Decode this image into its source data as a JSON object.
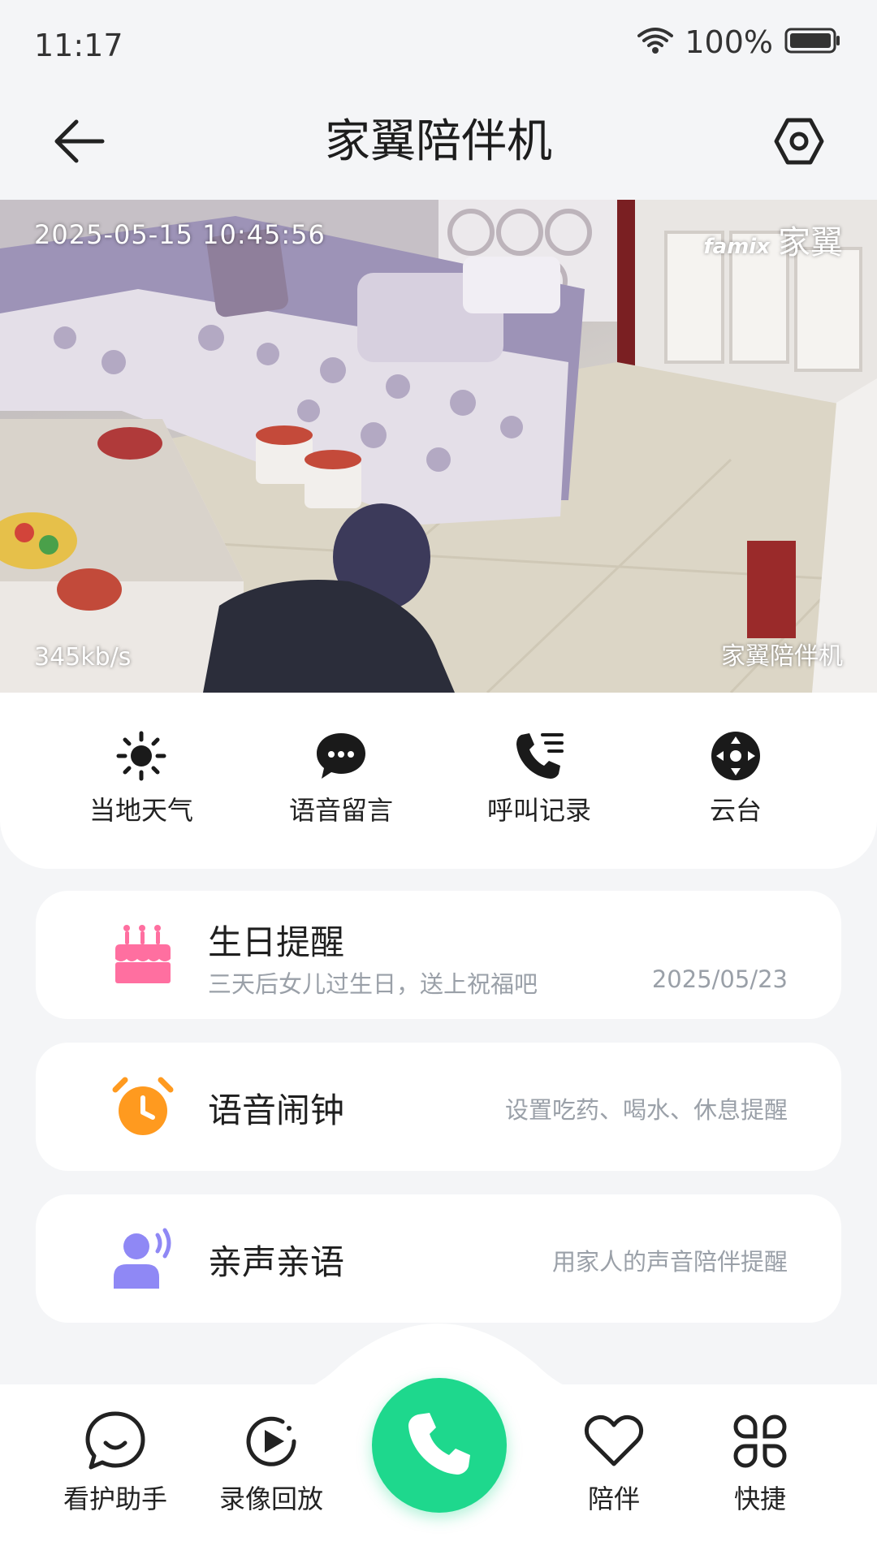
{
  "status_bar": {
    "time": "11:17",
    "battery_percent": "100%",
    "wifi_icon": "wifi-icon",
    "battery_icon": "battery-icon"
  },
  "header": {
    "title": "家翼陪伴机",
    "back_icon": "arrow-left-icon",
    "settings_icon": "hexagon-settings-icon"
  },
  "video": {
    "timestamp": "2025-05-15  10:45:56",
    "brand_en": "famix",
    "brand_cn": "家翼",
    "bitrate": "345kb/s",
    "device_label": "家翼陪伴机"
  },
  "quick_actions": [
    {
      "label": "当地天气",
      "icon": "sun-icon"
    },
    {
      "label": "语音留言",
      "icon": "chat-bubble-icon"
    },
    {
      "label": "呼叫记录",
      "icon": "call-log-icon"
    },
    {
      "label": "云台",
      "icon": "direction-pad-icon"
    }
  ],
  "cards": {
    "birthday": {
      "title": "生日提醒",
      "subtitle": "三天后女儿过生日，送上祝福吧",
      "date": "2025/05/23",
      "icon": "birthday-cake-icon",
      "color": "#ff6fa0"
    },
    "alarm": {
      "title": "语音闹钟",
      "hint": "设置吃药、喝水、休息提醒",
      "icon": "alarm-clock-icon",
      "color": "#ff9a1f"
    },
    "voice": {
      "title": "亲声亲语",
      "hint": "用家人的声音陪伴提醒",
      "icon": "person-voice-icon",
      "color": "#8f88f5"
    }
  },
  "bottom_nav": {
    "items": [
      {
        "label": "看护助手",
        "icon": "smile-chat-icon"
      },
      {
        "label": "录像回放",
        "icon": "playback-icon"
      },
      {
        "label": "陪伴",
        "icon": "heart-icon"
      },
      {
        "label": "快捷",
        "icon": "grid-shortcut-icon"
      }
    ],
    "call_icon": "phone-icon",
    "call_color": "#1ed88d"
  }
}
